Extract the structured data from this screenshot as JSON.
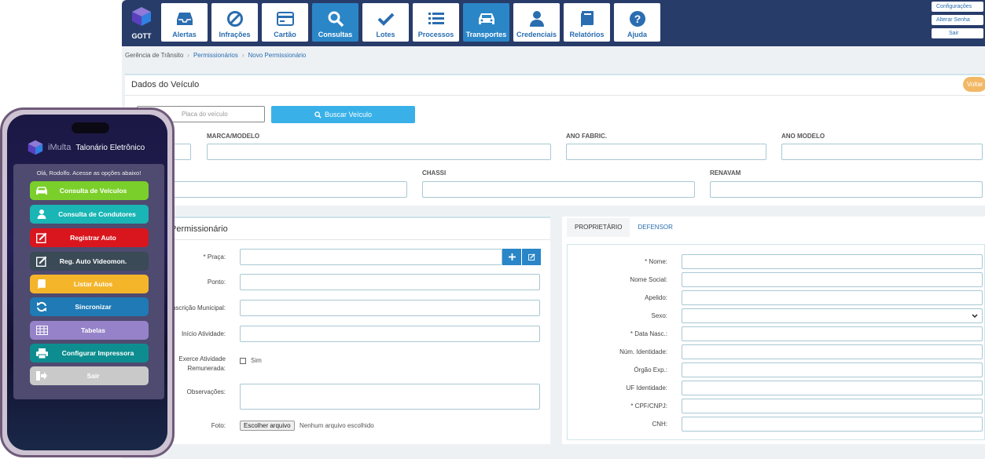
{
  "colors": {
    "topbar": "#283c6a",
    "nav_active": "#2a86c7",
    "accent_blue": "#39b1e8",
    "voltar": "#f2b865"
  },
  "app": {
    "brand": "GOTT",
    "nav": [
      {
        "label": "Alertas",
        "icon": "inbox-icon"
      },
      {
        "label": "Infrações",
        "icon": "no-entry-icon"
      },
      {
        "label": "Cartão",
        "icon": "card-icon"
      },
      {
        "label": "Consultas",
        "icon": "search-icon",
        "active": true
      },
      {
        "label": "Lotes",
        "icon": "check-icon"
      },
      {
        "label": "Processos",
        "icon": "list-icon"
      },
      {
        "label": "Transportes",
        "icon": "car-icon",
        "active": true
      },
      {
        "label": "Credenciais",
        "icon": "user-icon"
      },
      {
        "label": "Relatórios",
        "icon": "book-icon"
      },
      {
        "label": "Ajuda",
        "icon": "question-icon"
      }
    ],
    "user_links": [
      "Configurações",
      "Alterar Senha",
      "Sair"
    ]
  },
  "breadcrumb": [
    "Gerência de Trânsito",
    "Permissionários",
    "Novo Permissionário"
  ],
  "vehicle": {
    "title": "Dados do Veículo",
    "back_label": "Voltar",
    "plate_placeholder": "Placa do veículo",
    "search_button": "Buscar Veículo",
    "fields": {
      "marca_modelo": "MARCA/MODELO",
      "ano_fabric": "ANO FABRIC.",
      "ano_modelo": "ANO MODELO",
      "chassi": "CHASSI",
      "renavam": "RENAVAM"
    }
  },
  "permissionario": {
    "title": "Permissionário",
    "labels": {
      "praca": "* Praça:",
      "ponto": "Ponto:",
      "inscricao": "Inscrição Municipal:",
      "inicio": "Início Atividade:",
      "exerce": "Exerce Atividade Remunerada:",
      "observacoes": "Observações:",
      "foto": "Foto:"
    },
    "checkbox_label": "Sim",
    "file_button": "Escolher arquivo",
    "file_status": "Nenhum arquivo escolhido"
  },
  "owner": {
    "tabs": [
      "PROPRIETÁRIO",
      "DEFENSOR"
    ],
    "labels": [
      "* Nome:",
      "Nome Social:",
      "Apelido:",
      "Sexo:",
      "* Data Nasc.:",
      "Núm. Identidade:",
      "Órgão Exp.:",
      "UF Identidade:",
      "* CPF/CNPJ:",
      "CNH:"
    ]
  },
  "phone": {
    "app_name": "iMulta",
    "app_title": "Talonário Eletrônico",
    "greeting": "Olá, Rodolfo. Acesse as opções abaixo!",
    "menu": [
      {
        "label": "Consulta de Veículos",
        "color": "#7bcf2a",
        "icon": "car-icon"
      },
      {
        "label": "Consulta de Condutores",
        "color": "#1ab5b5",
        "icon": "user-icon"
      },
      {
        "label": "Registrar Auto",
        "color": "#d9161e",
        "icon": "edit-icon"
      },
      {
        "label": "Reg. Auto Videomon.",
        "color": "#3a4a56",
        "icon": "edit-icon"
      },
      {
        "label": "Listar Autos",
        "color": "#f4b52b",
        "icon": "book-icon"
      },
      {
        "label": "Sincronizar",
        "color": "#1f7ab5",
        "icon": "sync-icon"
      },
      {
        "label": "Tabelas",
        "color": "#9582c8",
        "icon": "table-icon"
      },
      {
        "label": "Configurar Impressora",
        "color": "#0d8d8f",
        "icon": "printer-icon"
      },
      {
        "label": "Sair",
        "color": "#c9c9c9",
        "icon": "logout-icon"
      }
    ]
  }
}
